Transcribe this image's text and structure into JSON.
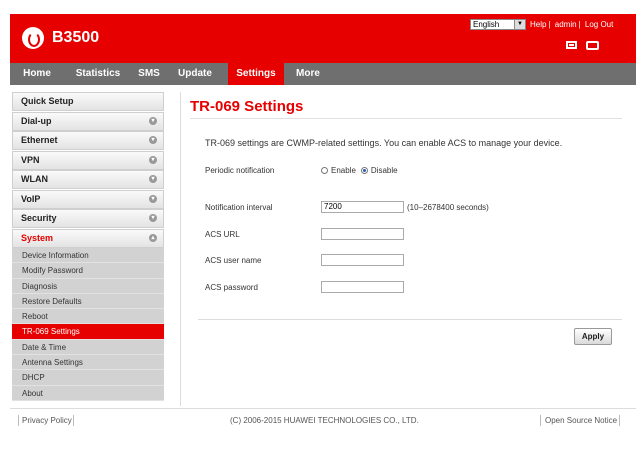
{
  "header": {
    "brand": "B3500",
    "language": "English",
    "help": "Help",
    "user": "admin",
    "logout": "Log Out",
    "colors": {
      "brand_red": "#e60000",
      "nav_gray": "#6f6f6f"
    }
  },
  "nav": {
    "items": [
      {
        "label": "Home"
      },
      {
        "label": "Statistics"
      },
      {
        "label": "SMS"
      },
      {
        "label": "Update"
      },
      {
        "label": "Settings",
        "active": true
      },
      {
        "label": "More"
      }
    ]
  },
  "sidebar": {
    "sections": [
      {
        "label": "Quick Setup"
      },
      {
        "label": "Dial-up"
      },
      {
        "label": "Ethernet"
      },
      {
        "label": "VPN"
      },
      {
        "label": "WLAN"
      },
      {
        "label": "VoIP"
      },
      {
        "label": "Security"
      },
      {
        "label": "System",
        "open": true
      }
    ],
    "system_items": [
      "Device Information",
      "Modify Password",
      "Diagnosis",
      "Restore Defaults",
      "Reboot",
      "TR-069 Settings",
      "Date & Time",
      "Antenna Settings",
      "DHCP",
      "About"
    ],
    "active_item": "TR-069 Settings"
  },
  "main": {
    "title": "TR-069 Settings",
    "intro": "TR-069 settings are CWMP-related settings. You can enable ACS to manage your device.",
    "periodic_label": "Periodic notification",
    "enable_label": "Enable",
    "disable_label": "Disable",
    "periodic_selected": "Disable",
    "interval_label": "Notification interval",
    "interval_value": "7200",
    "interval_hint": "(10–2678400 seconds)",
    "acs_url_label": "ACS URL",
    "acs_url_value": "",
    "acs_user_label": "ACS user name",
    "acs_user_value": "",
    "acs_password_label": "ACS password",
    "acs_password_value": "",
    "apply_label": "Apply"
  },
  "footer": {
    "privacy": "Privacy Policy",
    "copyright": "(C) 2006-2015 HUAWEI TECHNOLOGIES CO., LTD.",
    "open_source": "Open Source Notice"
  }
}
